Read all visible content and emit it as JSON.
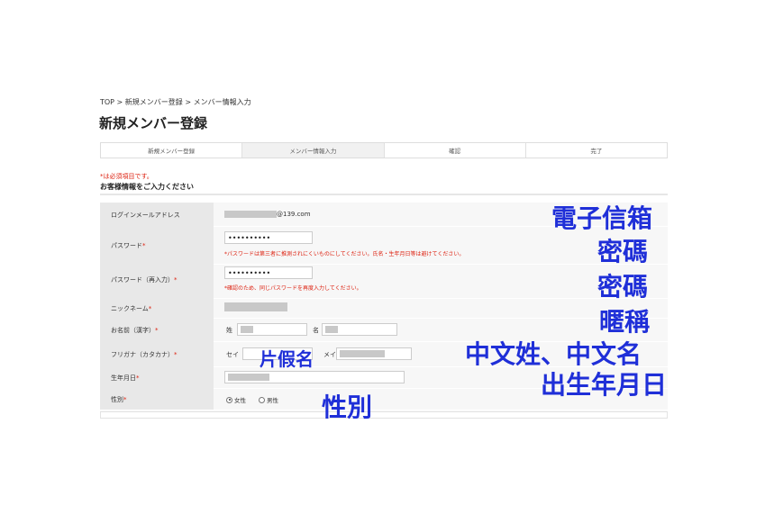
{
  "breadcrumb": "TOP > 新規メンバー登録 > メンバー情報入力",
  "page_title": "新規メンバー登録",
  "steps": [
    "新規メンバー登録",
    "メンバー情報入力",
    "確認",
    "完了"
  ],
  "required_note": "*は必須項目です。",
  "section_title": "お客様情報をご入力ください",
  "required_mark": "*",
  "form": {
    "email": {
      "label": "ログインメールアドレス",
      "value_suffix": "@139.com"
    },
    "password": {
      "label": "パスワード",
      "value": "••••••••••",
      "hint": "*パスワードは第三者に推測されにくいものにしてください。氏名・生年月日等は避けてください。"
    },
    "password_confirm": {
      "label": "パスワード（再入力）",
      "value": "••••••••••",
      "hint": "*確認のため、同じパスワードを再度入力してください。"
    },
    "nickname": {
      "label": "ニックネーム"
    },
    "name_kanji": {
      "label": "お名前（漢字）",
      "last_label": "姓",
      "first_label": "名"
    },
    "name_kana": {
      "label": "フリガナ（カタカナ）",
      "last_label": "セイ",
      "first_label": "メイ"
    },
    "birthdate": {
      "label": "生年月日"
    },
    "gender": {
      "label": "性別",
      "options": [
        "女性",
        "男性"
      ],
      "selected": "女性"
    }
  },
  "annotations": {
    "email": "電子信箱",
    "password": "密碼",
    "password_confirm": "密碼",
    "nickname": "暱稱",
    "kana": "片假名",
    "name": "中文姓、中文名",
    "birthdate": "出生年月日",
    "gender": "性別"
  },
  "colors": {
    "annotation": "#1f2fd8",
    "required": "#dd2211",
    "label_bg": "#e8e8e8",
    "form_bg": "#f7f7f7"
  }
}
